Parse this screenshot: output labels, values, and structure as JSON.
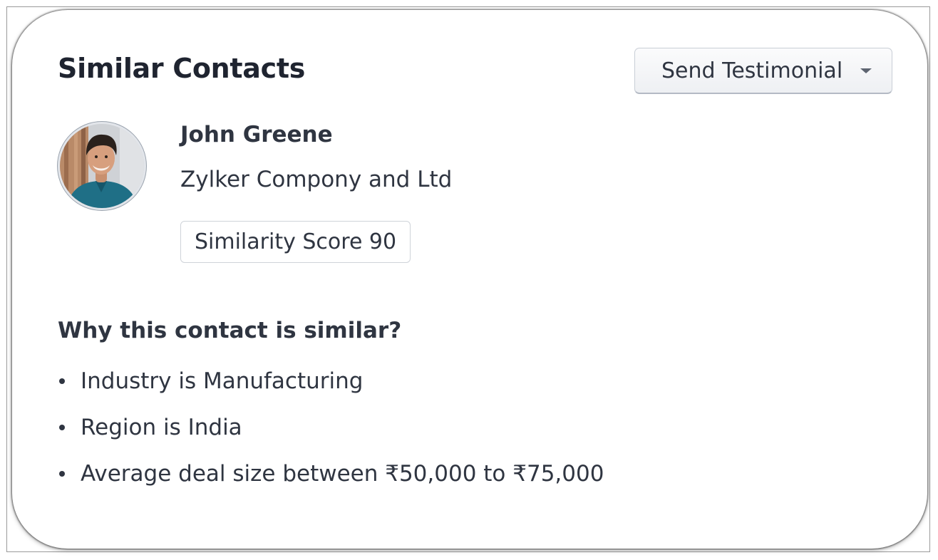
{
  "card": {
    "title": "Similar Contacts",
    "action_button": {
      "label": "Send Testimonial",
      "icon": "caret-down-icon"
    }
  },
  "contact": {
    "avatar_icon": "contact-avatar-photo",
    "name": "John Greene",
    "company": "Zylker Compony and Ltd",
    "similarity_badge": "Similarity Score 90"
  },
  "reasons": {
    "heading": "Why this contact is similar?",
    "items": [
      "Industry is Manufacturing",
      "Region is India",
      "Average deal size between ₹50,000 to ₹75,000"
    ]
  },
  "colors": {
    "text": "#2f3541",
    "title": "#1f2430",
    "border": "#cfd3d9",
    "avatar_shirt": "#1f6f86"
  }
}
